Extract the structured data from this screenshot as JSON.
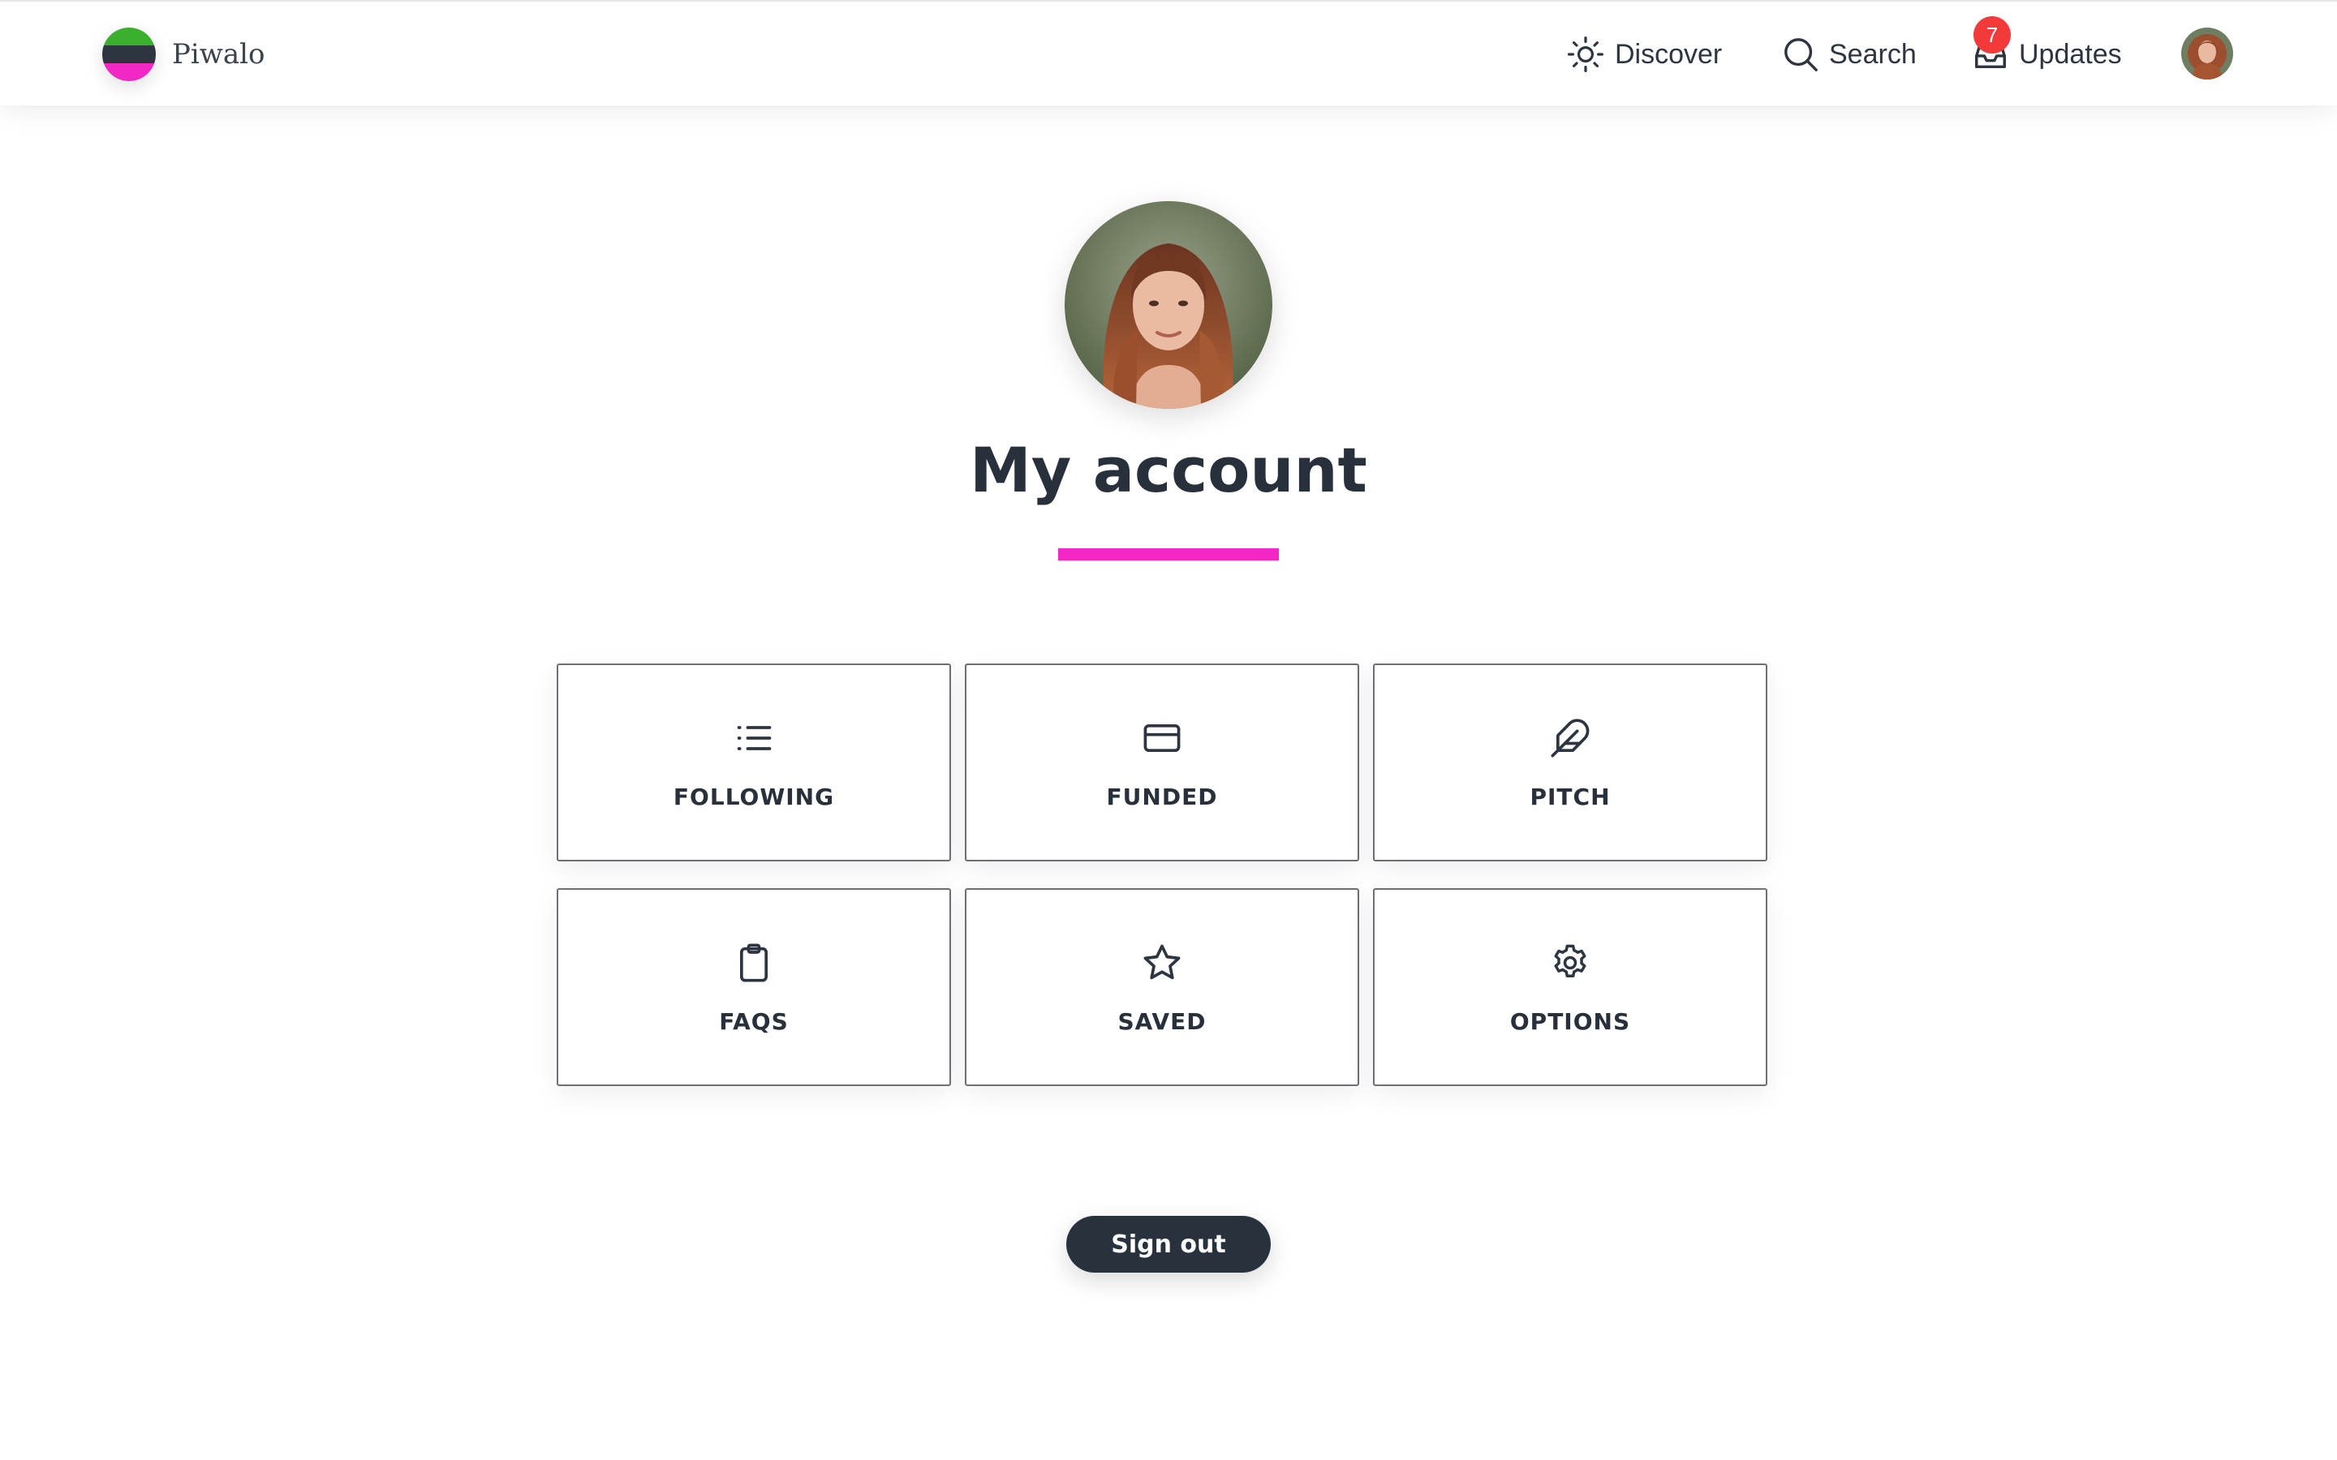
{
  "header": {
    "brand_name": "Piwalo",
    "nav": {
      "discover_label": "Discover",
      "search_label": "Search",
      "updates_label": "Updates",
      "updates_badge": "7"
    }
  },
  "main": {
    "title": "My account",
    "tiles": [
      {
        "label": "FOLLOWING",
        "icon": "list-icon"
      },
      {
        "label": "FUNDED",
        "icon": "credit-card-icon"
      },
      {
        "label": "PITCH",
        "icon": "feather-icon"
      },
      {
        "label": "FAQS",
        "icon": "clipboard-icon"
      },
      {
        "label": "SAVED",
        "icon": "star-icon"
      },
      {
        "label": "OPTIONS",
        "icon": "gear-icon"
      }
    ],
    "signout_label": "Sign out"
  },
  "colors": {
    "accent": "#f227c6",
    "logo_green": "#3bb02c",
    "logo_dark": "#2d3540",
    "logo_pink": "#f227c6",
    "badge": "#f23a3a",
    "button": "#27323d",
    "text": "#2d3540"
  }
}
